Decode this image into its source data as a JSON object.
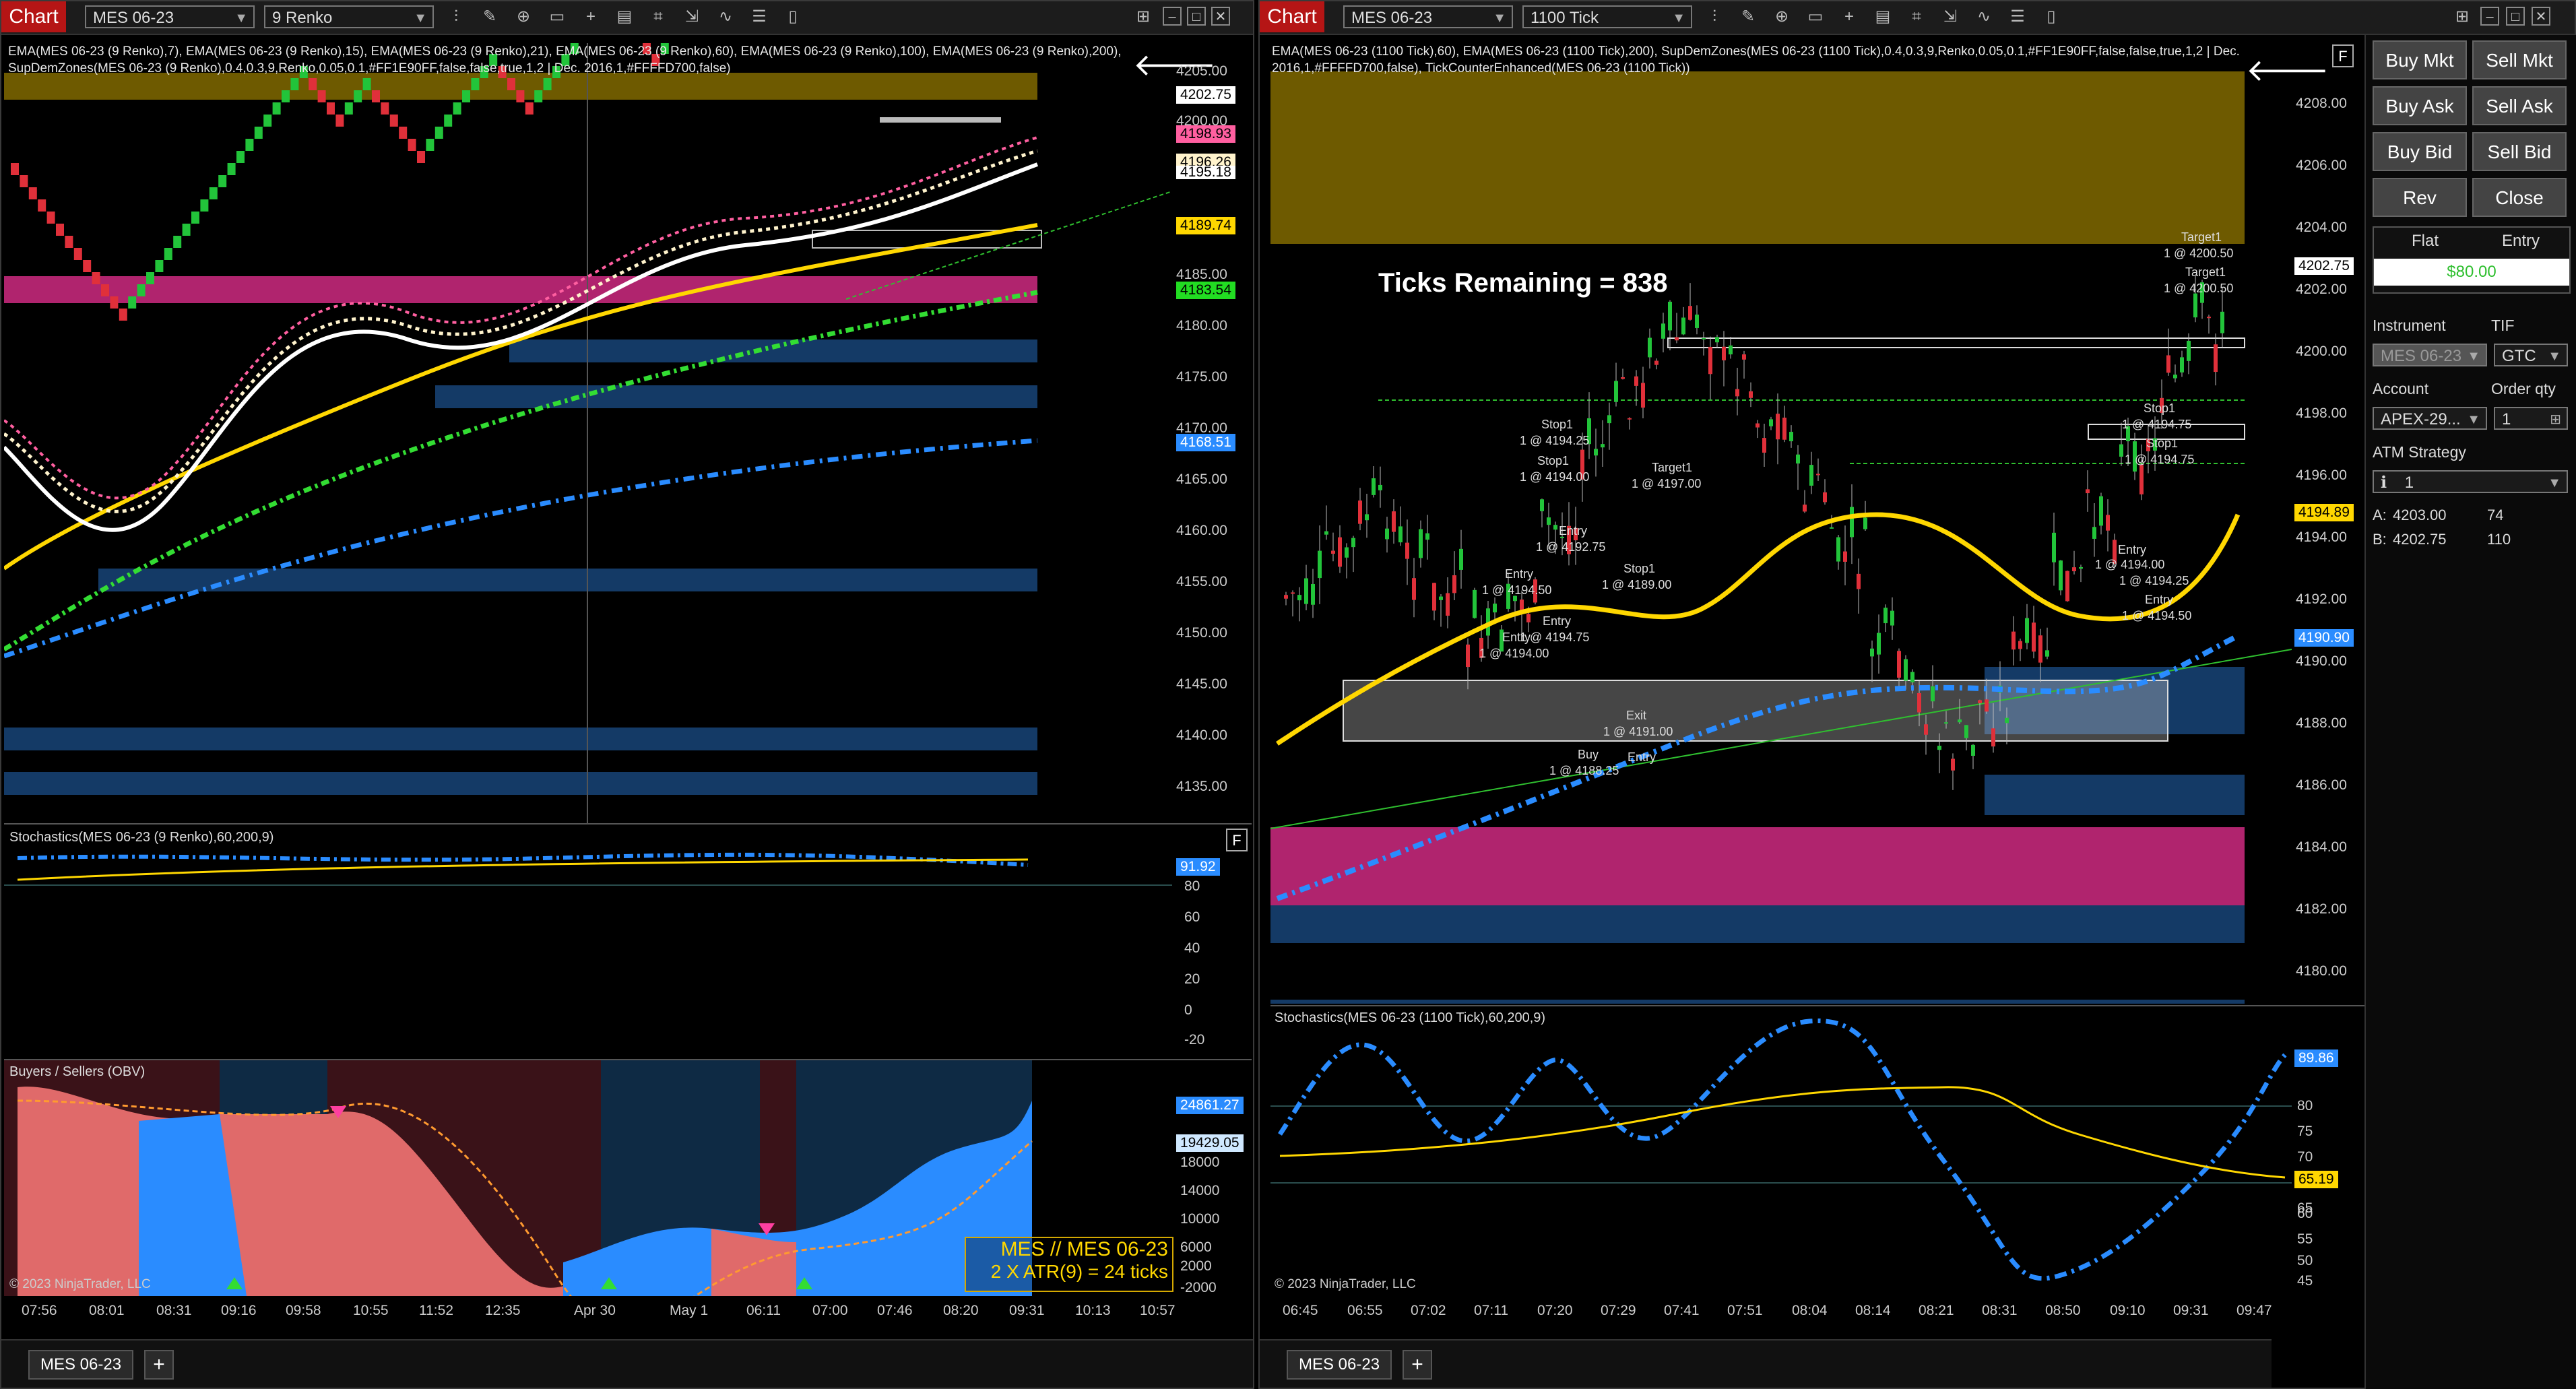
{
  "left": {
    "title": "Chart",
    "instrument": "MES 06-23",
    "period": "9 Renko",
    "indicators": "EMA(MES 06-23 (9 Renko),7), EMA(MES 06-23 (9 Renko),15), EMA(MES 06-23 (9 Renko),21), EMA(MES 06-23 (9 Renko),60), EMA(MES 06-23 (9 Renko),100), EMA(MES 06-23 (9 Renko),200), SupDemZones(MES 06-23 (9 Renko),0.4,0.3,9,Renko,0.05,0.1,#FF1E90FF,false,false,true,1,2 | Dec. 2016,1,#FFFFD700,false)",
    "price_axis": [
      "4205.00",
      "4200.00",
      "4185.00",
      "4180.00",
      "4175.00",
      "4170.00",
      "4165.00",
      "4160.00",
      "4155.00",
      "4150.00",
      "4145.00",
      "4140.00",
      "4135.00"
    ],
    "price_tags": [
      {
        "label": "4202.75",
        "color": "#ffffff"
      },
      {
        "label": "4198.93",
        "color": "#ff5fa0"
      },
      {
        "label": "4196.26",
        "color": "#fff3cc"
      },
      {
        "label": "4195.18",
        "color": "#ffffff"
      },
      {
        "label": "4189.74",
        "color": "#ffd700"
      },
      {
        "label": "4183.54",
        "color": "#22dd22"
      },
      {
        "label": "4168.51",
        "color": "#2a8cff"
      }
    ],
    "stoch_title": "Stochastics(MES 06-23 (9 Renko),60,200,9)",
    "stoch_axis": [
      "80",
      "60",
      "40",
      "20",
      "0",
      "-20"
    ],
    "stoch_tag": "91.92",
    "obv_title": "Buyers /  Sellers (OBV)",
    "obv_axis": [
      "18000",
      "14000",
      "10000",
      "6000",
      "2000",
      "-2000"
    ],
    "obv_tags": [
      "24861.27",
      "19429.05"
    ],
    "note_line1": "MES // MES 06-23",
    "note_line2": "2 X ATR(9) = 24 ticks",
    "copyright": "© 2023 NinjaTrader, LLC",
    "time_axis": [
      "07:56",
      "08:01",
      "08:31",
      "09:16",
      "09:58",
      "10:55",
      "11:52",
      "12:35",
      "Apr 30",
      "May 1",
      "06:11",
      "07:00",
      "07:46",
      "08:20",
      "09:31",
      "10:13",
      "10:57"
    ],
    "tab": "MES 06-23",
    "add_tab": "+"
  },
  "right": {
    "title": "Chart",
    "instrument": "MES 06-23",
    "period": "1100 Tick",
    "indicators": "EMA(MES 06-23 (1100 Tick),60), EMA(MES 06-23 (1100 Tick),200), SupDemZones(MES 06-23 (1100 Tick),0.4,0.3,9,Renko,0.05,0.1,#FF1E90FF,false,false,true,1,2 | Dec. 2016,1,#FFFFD700,false), TickCounterEnhanced(MES 06-23 (1100 Tick))",
    "ticks_remaining": "Ticks Remaining = 838",
    "price_axis": [
      "4208.00",
      "4206.00",
      "4204.00",
      "4202.00",
      "4200.00",
      "4198.00",
      "4196.00",
      "4194.00",
      "4192.00",
      "4190.00",
      "4188.00",
      "4186.00",
      "4184.00",
      "4182.00",
      "4180.00"
    ],
    "price_tags": [
      {
        "label": "4202.75",
        "color": "#ffffff"
      },
      {
        "label": "4194.89",
        "color": "#ffd700"
      },
      {
        "label": "4190.90",
        "color": "#2a8cff"
      }
    ],
    "trade_labels": [
      {
        "text": "Target1"
      },
      {
        "text": "1 @ 4200.50"
      },
      {
        "text": "Target1"
      },
      {
        "text": "1 @ 4200.50"
      },
      {
        "text": "Stop1"
      },
      {
        "text": "1 @ 4194.75"
      },
      {
        "text": "Stop1"
      },
      {
        "text": "1 @ 4194.75"
      },
      {
        "text": "Entry"
      },
      {
        "text": "1 @ 4194.00"
      },
      {
        "text": "1 @ 4194.25"
      },
      {
        "text": "Entry"
      },
      {
        "text": "1 @ 4194.50"
      },
      {
        "text": "Stop1"
      },
      {
        "text": "1 @ 4194.25"
      },
      {
        "text": "Stop1"
      },
      {
        "text": "1 @ 4194.00"
      },
      {
        "text": "Target1"
      },
      {
        "text": "1 @ 4197.00"
      },
      {
        "text": "Entry"
      },
      {
        "text": "1 @ 4192.75"
      },
      {
        "text": "Stop1"
      },
      {
        "text": "1 @ 4189.00"
      },
      {
        "text": "Entry"
      },
      {
        "text": "1 @ 4194.50"
      },
      {
        "text": "Entry"
      },
      {
        "text": "1 @ 4194.75"
      },
      {
        "text": "Entry"
      },
      {
        "text": "1 @ 4194.00"
      },
      {
        "text": "Exit"
      },
      {
        "text": "1 @ 4191.00"
      },
      {
        "text": "Buy"
      },
      {
        "text": "1 @ 4188.25"
      },
      {
        "text": "Entry"
      }
    ],
    "stoch_title": "Stochastics(MES 06-23 (1100 Tick),60,200,9)",
    "stoch_axis": [
      "80",
      "75",
      "70",
      "65",
      "60",
      "55",
      "50",
      "45"
    ],
    "stoch_tags": [
      "89.86",
      "65.19"
    ],
    "copyright": "© 2023 NinjaTrader, LLC",
    "time_axis": [
      "06:45",
      "06:55",
      "07:02",
      "07:11",
      "07:20",
      "07:29",
      "07:41",
      "07:51",
      "08:04",
      "08:14",
      "08:21",
      "08:31",
      "08:50",
      "09:10",
      "09:31",
      "09:47"
    ],
    "tab": "MES 06-23",
    "add_tab": "+"
  },
  "chart_trader": {
    "buttons": [
      "Buy Mkt",
      "Sell Mkt",
      "Buy Ask",
      "Sell Ask",
      "Buy Bid",
      "Sell Bid",
      "Rev",
      "Close"
    ],
    "position_label": "Flat",
    "entry_label": "Entry",
    "pnl": "$80.00",
    "instrument_label": "Instrument",
    "instrument_value": "MES 06-23",
    "tif_label": "TIF",
    "tif_value": "GTC",
    "account_label": "Account",
    "account_value": "APEX-29...",
    "order_qty_label": "Order qty",
    "order_qty_value": "1",
    "atm_label": "ATM Strategy",
    "atm_value": "1",
    "ask_label": "A:",
    "ask_price": "4203.00",
    "ask_size": "74",
    "bid_label": "B:",
    "bid_price": "4202.75",
    "bid_size": "110"
  },
  "colors": {
    "supply_zone": "#6e5a00",
    "magenta_zone": "#b0246e",
    "demand_zone": "#143a66",
    "up_bar": "#22c43a",
    "down_bar": "#e0303a",
    "ema_yellow": "#ffd700",
    "ema_green": "#33dd33",
    "ema_blue": "#2a8cff"
  }
}
